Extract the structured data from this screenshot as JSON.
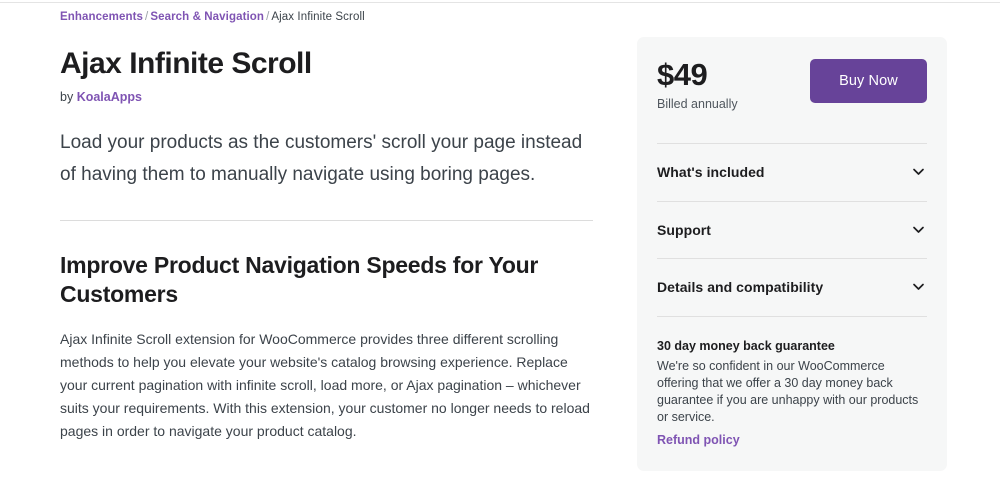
{
  "breadcrumb": {
    "items": [
      {
        "label": "Enhancements",
        "is_link": true
      },
      {
        "label": "Search & Navigation",
        "is_link": true
      },
      {
        "label": "Ajax Infinite Scroll",
        "is_link": false
      }
    ],
    "separator": "/"
  },
  "product": {
    "title": "Ajax Infinite Scroll",
    "by_prefix": "by",
    "author": "KoalaApps",
    "lede": "Load your products as the customers' scroll your page instead of having them to manually navigate using boring pages.",
    "section_heading": "Improve Product Navigation Speeds for Your Customers",
    "body": "Ajax Infinite Scroll extension for WooCommerce provides three different scrolling methods to help you elevate your website's catalog browsing experience. Replace your current pagination with infinite scroll, load more, or Ajax pagination – whichever suits your requirements. With this extension, your customer no longer needs to reload pages in order to navigate your product catalog."
  },
  "buy_card": {
    "price": "$49",
    "billing_note": "Billed annually",
    "buy_button": "Buy Now",
    "accordion": [
      {
        "label": "What's included",
        "icon": "chevron-down-icon"
      },
      {
        "label": "Support",
        "icon": "chevron-down-icon"
      },
      {
        "label": "Details and compatibility",
        "icon": "chevron-down-icon"
      }
    ],
    "guarantee": {
      "title": "30 day money back guarantee",
      "text": "We're so confident in our WooCommerce offering that we offer a 30 day money back guarantee if you are unhappy with our products or service.",
      "link": "Refund policy"
    }
  },
  "colors": {
    "accent_purple": "#7f54b3",
    "button_purple": "#674399",
    "card_bg": "#f6f7f7",
    "text_dark": "#1d1d1f",
    "text_body": "#3c434a"
  }
}
